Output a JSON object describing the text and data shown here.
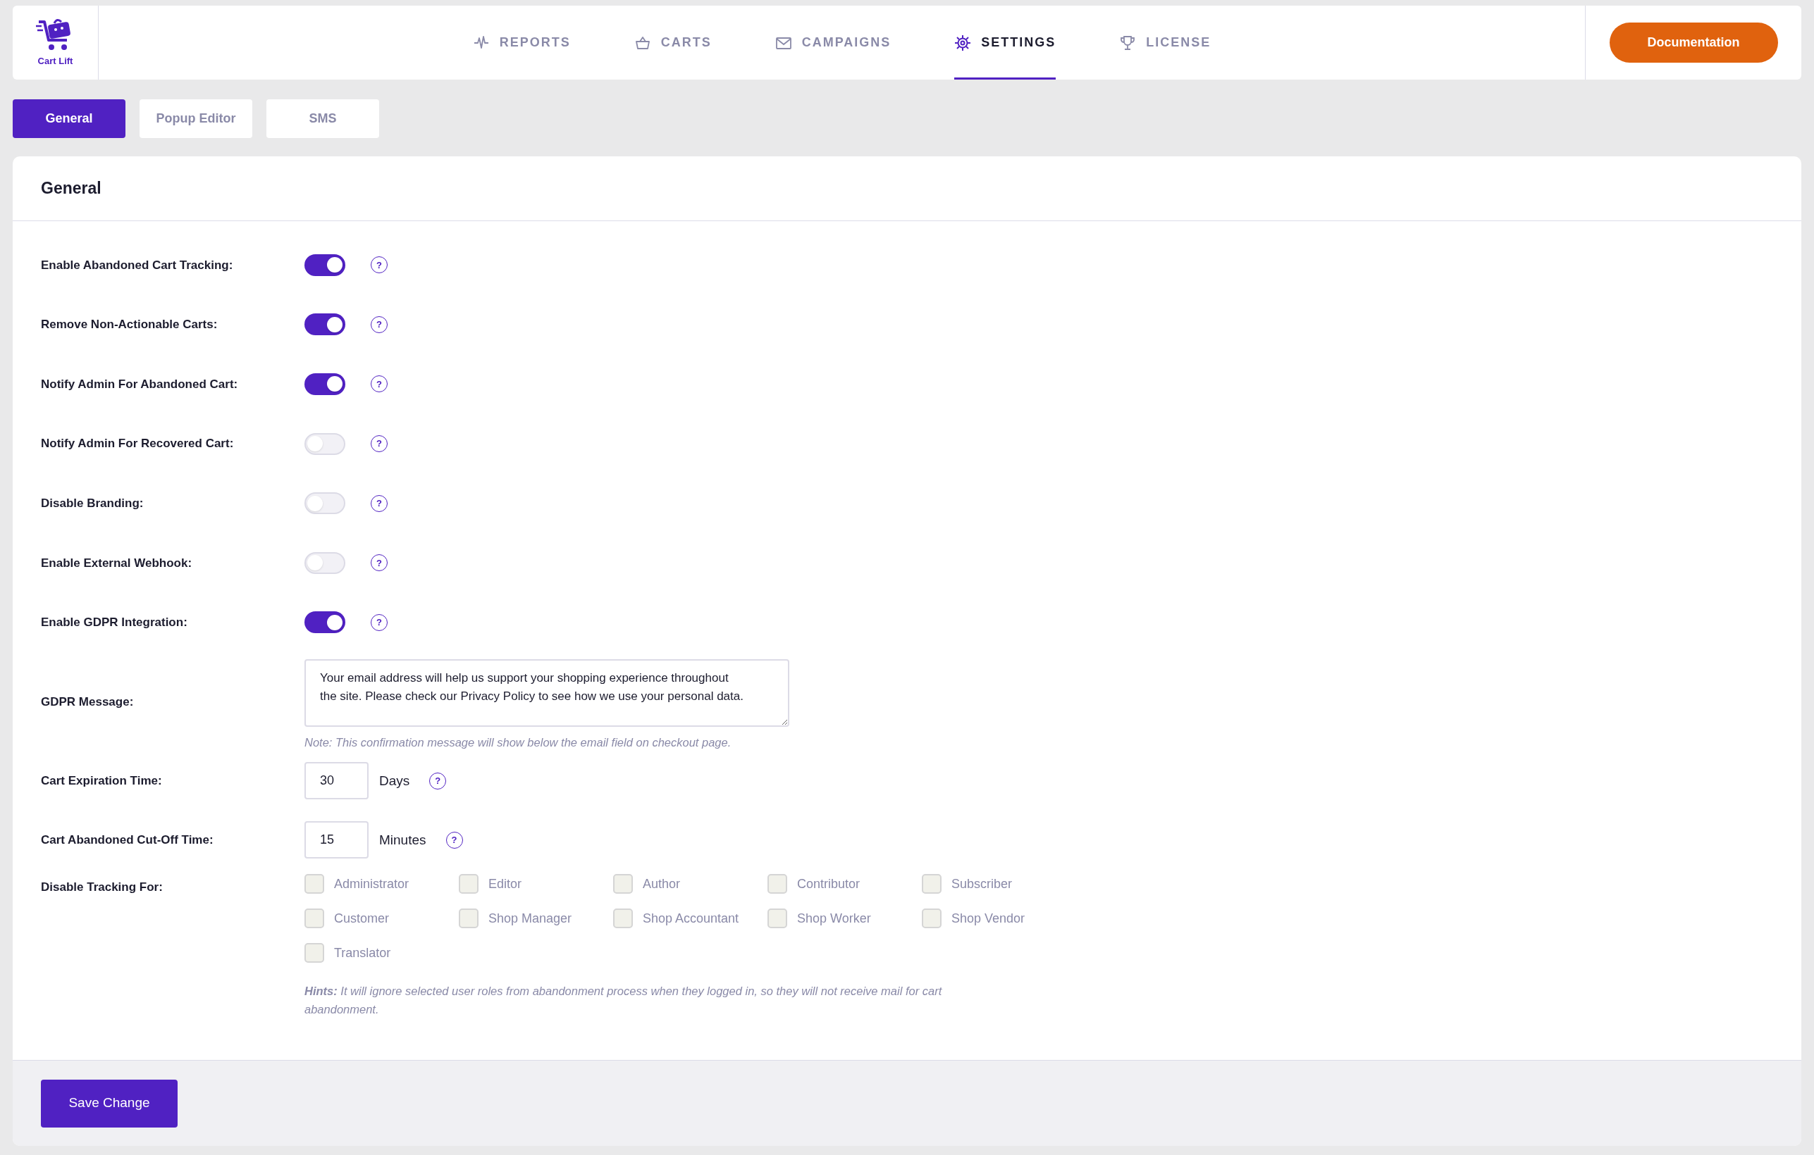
{
  "logo": {
    "text": "Cart Lift"
  },
  "nav": [
    {
      "label": "REPORTS",
      "selected": false
    },
    {
      "label": "CARTS",
      "selected": false
    },
    {
      "label": "CAMPAIGNS",
      "selected": false
    },
    {
      "label": "SETTINGS",
      "selected": true
    },
    {
      "label": "LICENSE",
      "selected": false
    }
  ],
  "documentation_button": "Documentation",
  "tabs": [
    {
      "label": "General",
      "selected": true
    },
    {
      "label": "Popup Editor",
      "selected": false
    },
    {
      "label": "SMS",
      "selected": false
    }
  ],
  "panel": {
    "title": "General",
    "rows": [
      {
        "kind": "toggle",
        "label": "Enable Abandoned Cart Tracking:",
        "on": true,
        "help": "?"
      },
      {
        "kind": "toggle",
        "label": "Remove Non-Actionable Carts:",
        "on": true,
        "help": "?"
      },
      {
        "kind": "toggle",
        "label": "Notify Admin For Abandoned Cart:",
        "on": true,
        "help": "?"
      },
      {
        "kind": "toggle",
        "label": "Notify Admin For Recovered Cart:",
        "on": false,
        "help": "?"
      },
      {
        "kind": "toggle",
        "label": "Disable Branding:",
        "on": false,
        "help": "?"
      },
      {
        "kind": "toggle",
        "label": "Enable External Webhook:",
        "on": false,
        "help": "?"
      },
      {
        "kind": "toggle",
        "label": "Enable GDPR Integration:",
        "on": true,
        "help": "?"
      },
      {
        "kind": "textarea",
        "label": "GDPR Message:",
        "value": "Your email address will help us support your shopping experience throughout the site. Please check our Privacy Policy to see how we use your personal data.",
        "note": "Note: This confirmation message will show below the email field on checkout page."
      },
      {
        "kind": "number",
        "label": "Cart Expiration Time:",
        "value": "30",
        "unit": "Days",
        "help": "?"
      },
      {
        "kind": "number",
        "label": "Cart Abandoned Cut-Off Time:",
        "value": "15",
        "unit": "Minutes",
        "help": "?"
      },
      {
        "kind": "checkboxes",
        "label": "Disable Tracking For:",
        "options": [
          {
            "label": "Administrator",
            "checked": false
          },
          {
            "label": "Editor",
            "checked": false
          },
          {
            "label": "Author",
            "checked": false
          },
          {
            "label": "Contributor",
            "checked": false
          },
          {
            "label": "Subscriber",
            "checked": false
          },
          {
            "label": "Customer",
            "checked": false
          },
          {
            "label": "Shop Manager",
            "checked": false
          },
          {
            "label": "Shop Accountant",
            "checked": false
          },
          {
            "label": "Shop Worker",
            "checked": false
          },
          {
            "label": "Shop Vendor",
            "checked": false
          },
          {
            "label": "Translator",
            "checked": false
          }
        ],
        "hint": "**Hints:** It will ignore selected user roles from abandonment process when they logged in, so they will not receive mail for cart abandonment."
      }
    ]
  },
  "save_button": "Save Change"
}
